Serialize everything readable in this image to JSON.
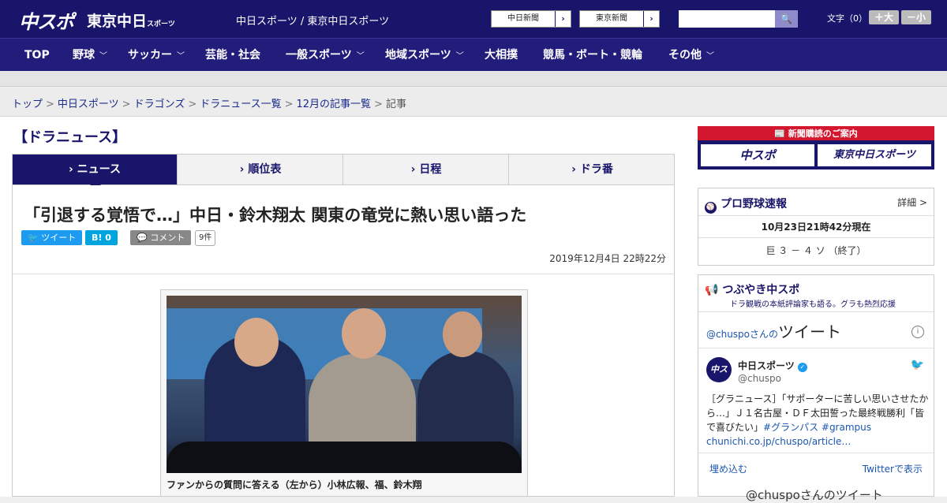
{
  "header": {
    "logo_main": "中スポ",
    "logo_tokyo": "東京中日",
    "logo_tokyo_suffix": "スポーツ",
    "site_name": "中日スポーツ / 東京中日スポーツ",
    "sister_sites": [
      {
        "label": "中日新聞"
      },
      {
        "label": "東京新聞"
      }
    ],
    "search_placeholder": "",
    "font_label": "文字（0）",
    "font_larger": "＋大",
    "font_smaller": "－小",
    "brand_color": "#19156b"
  },
  "nav": [
    {
      "label": "TOP",
      "dropdown": false
    },
    {
      "label": "野球",
      "dropdown": true
    },
    {
      "label": "サッカー",
      "dropdown": true
    },
    {
      "label": "芸能・社会",
      "dropdown": false
    },
    {
      "label": "一般スポーツ",
      "dropdown": true
    },
    {
      "label": "地域スポーツ",
      "dropdown": true
    },
    {
      "label": "大相撲",
      "dropdown": false
    },
    {
      "label": "競馬・ボート・競輪",
      "dropdown": false
    },
    {
      "label": "その他",
      "dropdown": true
    }
  ],
  "breadcrumb": {
    "links": [
      "トップ",
      "中日スポーツ",
      "ドラゴンズ",
      "ドラニュース一覧",
      "12月の記事一覧"
    ],
    "current": "記事",
    "separator": ">"
  },
  "section_title": "【ドラニュース】",
  "tabs": [
    {
      "label": "ニュース",
      "active": true
    },
    {
      "label": "順位表",
      "active": false
    },
    {
      "label": "日程",
      "active": false
    },
    {
      "label": "ドラ番",
      "active": false
    }
  ],
  "article": {
    "headline": "「引退する覚悟で…」中日・鈴木翔太 関東の竜党に熱い思い語った",
    "tweet_label": "ツイート",
    "hatena_label": "B! 0",
    "comment_label": "コメント",
    "comment_count": "9件",
    "date": "2019年12月4日 22時22分",
    "photo_caption": "ファンからの質問に答える（左から）小林広報、福、鈴木翔"
  },
  "sidebar": {
    "subscription_title": "新聞購読のご案内",
    "subscription_options": [
      "中スポ",
      "東京中日スポーツ"
    ],
    "baseball": {
      "title": "プロ野球速報",
      "more": "詳細 >",
      "updated": "10月23日21時42分現在",
      "score": "巨 ３ － ４ ソ （終了）"
    },
    "twitter": {
      "title": "つぶやき中スポ",
      "subtitle": "ドラ観戦の本紙評論家も語る。グラも熱烈応援",
      "handle_suffix": "@chuspoさんの",
      "tweets_word": "ツイート",
      "account_name": "中日スポーツ",
      "account_handle": "@chuspo",
      "tweet_text": "［グラニュース］「サポーターに苦しい思いさせたから…」Ｊ１名古屋・ＤＦ太田誓った最終戦勝利「皆で喜びたい」",
      "tweet_tags": "#グランパス #grampus",
      "tweet_link": "chunichi.co.jp/chuspo/article…",
      "embed_label": "埋め込む",
      "view_label": "Twitterで表示",
      "more_tweets": "@chuspoさんのツイート"
    }
  }
}
